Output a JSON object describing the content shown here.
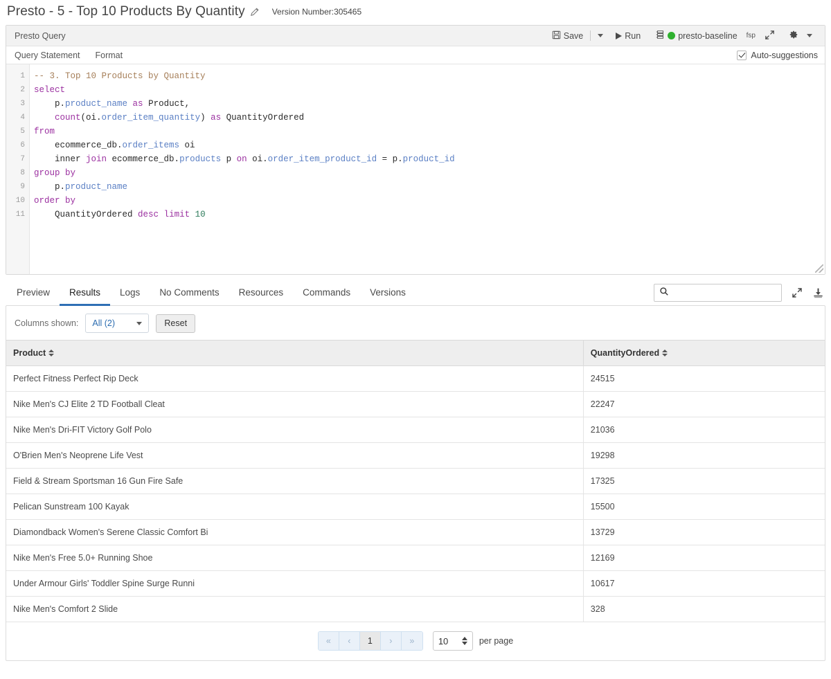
{
  "header": {
    "title": "Presto - 5 - Top 10 Products By Quantity",
    "edit_icon": "pencil-icon",
    "version_label": "Version Number:305465"
  },
  "query_panel": {
    "panel_title": "Presto Query",
    "toolbar": {
      "save_label": "Save",
      "save_icon": "floppy-disk-icon",
      "save_dropdown_icon": "caret-down-icon",
      "run_label": "Run",
      "run_icon": "play-icon",
      "cluster_icon": "database-icon",
      "cluster_status_color": "#2fb12f",
      "cluster_label": "presto-baseline",
      "fsp_label": "fsp",
      "expand_icon": "expand-arrows-icon",
      "settings_icon": "gear-icon",
      "settings_dropdown_icon": "caret-down-icon"
    },
    "sub_tabs": [
      "Query Statement",
      "Format"
    ],
    "autosuggestions": {
      "label": "Auto-suggestions",
      "checked": true
    },
    "editor": {
      "line_numbers": [
        "1",
        "2",
        "3",
        "4",
        "5",
        "6",
        "7",
        "8",
        "9",
        "10",
        "11"
      ],
      "lines": [
        [
          {
            "t": "-- 3. Top 10 Products by Quantity",
            "c": "cmt"
          }
        ],
        [
          {
            "t": "select",
            "c": "kw"
          }
        ],
        [
          {
            "t": "    p.",
            "c": ""
          },
          {
            "t": "product_name",
            "c": "ident"
          },
          {
            "t": " ",
            "c": ""
          },
          {
            "t": "as",
            "c": "kw"
          },
          {
            "t": " Product,",
            "c": ""
          }
        ],
        [
          {
            "t": "    ",
            "c": ""
          },
          {
            "t": "count",
            "c": "kw"
          },
          {
            "t": "(oi.",
            "c": ""
          },
          {
            "t": "order_item_quantity",
            "c": "ident"
          },
          {
            "t": ") ",
            "c": ""
          },
          {
            "t": "as",
            "c": "kw"
          },
          {
            "t": " QuantityOrdered",
            "c": ""
          }
        ],
        [
          {
            "t": "from",
            "c": "kw"
          }
        ],
        [
          {
            "t": "    ecommerce_db.",
            "c": ""
          },
          {
            "t": "order_items",
            "c": "ident"
          },
          {
            "t": " oi",
            "c": ""
          }
        ],
        [
          {
            "t": "    inner ",
            "c": ""
          },
          {
            "t": "join",
            "c": "kw"
          },
          {
            "t": " ecommerce_db.",
            "c": ""
          },
          {
            "t": "products",
            "c": "ident"
          },
          {
            "t": " p ",
            "c": ""
          },
          {
            "t": "on",
            "c": "kw"
          },
          {
            "t": " oi.",
            "c": ""
          },
          {
            "t": "order_item_product_id",
            "c": "ident"
          },
          {
            "t": " = p.",
            "c": ""
          },
          {
            "t": "product_id",
            "c": "ident"
          }
        ],
        [
          {
            "t": "group by",
            "c": "kw"
          }
        ],
        [
          {
            "t": "    p.",
            "c": ""
          },
          {
            "t": "product_name",
            "c": "ident"
          }
        ],
        [
          {
            "t": "order by",
            "c": "kw"
          }
        ],
        [
          {
            "t": "    QuantityOrdered ",
            "c": ""
          },
          {
            "t": "desc",
            "c": "kw"
          },
          {
            "t": " ",
            "c": ""
          },
          {
            "t": "limit",
            "c": "kw"
          },
          {
            "t": " ",
            "c": ""
          },
          {
            "t": "10",
            "c": "num"
          }
        ]
      ]
    },
    "resize_handle": "resize-grip"
  },
  "results": {
    "tabs": [
      {
        "label": "Preview",
        "active": false
      },
      {
        "label": "Results",
        "active": true
      },
      {
        "label": "Logs",
        "active": false
      },
      {
        "label": "No Comments",
        "active": false
      },
      {
        "label": "Resources",
        "active": false
      },
      {
        "label": "Commands",
        "active": false
      },
      {
        "label": "Versions",
        "active": false
      }
    ],
    "search": {
      "value": "",
      "placeholder": "",
      "icon": "search-icon"
    },
    "expand_icon": "expand-arrows-icon",
    "download_icon": "download-icon",
    "columns_bar": {
      "label": "Columns shown:",
      "select_value": "All (2)",
      "select_caret": "caret-down-icon",
      "reset_label": "Reset"
    },
    "table": {
      "columns": [
        "Product",
        "QuantityOrdered"
      ],
      "rows": [
        [
          "Perfect Fitness Perfect Rip Deck",
          "24515"
        ],
        [
          "Nike Men's CJ Elite 2 TD Football Cleat",
          "22247"
        ],
        [
          "Nike Men's Dri-FIT Victory Golf Polo",
          "21036"
        ],
        [
          "O'Brien Men's Neoprene Life Vest",
          "19298"
        ],
        [
          "Field & Stream Sportsman 16 Gun Fire Safe",
          "17325"
        ],
        [
          "Pelican Sunstream 100 Kayak",
          "15500"
        ],
        [
          "Diamondback Women's Serene Classic Comfort Bi",
          "13729"
        ],
        [
          "Nike Men's Free 5.0+ Running Shoe",
          "12169"
        ],
        [
          "Under Armour Girls' Toddler Spine Surge Runni",
          "10617"
        ],
        [
          "Nike Men's Comfort 2 Slide",
          "328"
        ]
      ]
    },
    "pagination": {
      "first_label": "«",
      "prev_label": "‹",
      "current_page": "1",
      "next_label": "›",
      "last_label": "»",
      "per_page_value": "10",
      "per_page_label": "per page"
    }
  },
  "colors": {
    "accent": "#2f6fb5",
    "status_green": "#2fb12f",
    "link_blue": "#2b6cb0"
  }
}
